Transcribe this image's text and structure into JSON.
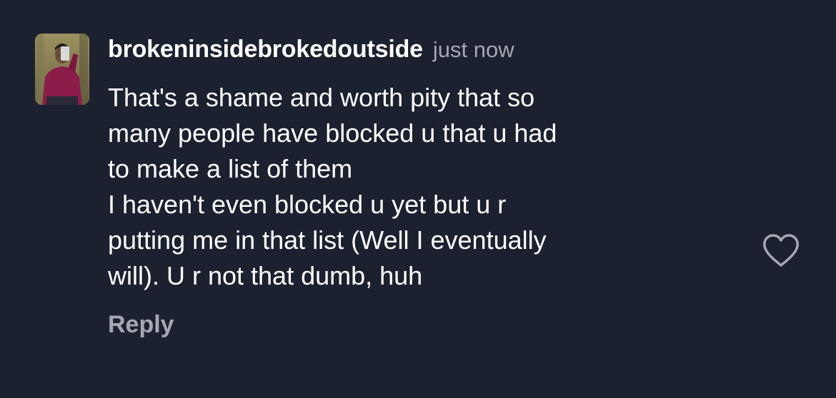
{
  "comment": {
    "username": "brokeninsidebrokedoutside",
    "timestamp": "just now",
    "text_lines": [
      "That's a shame and worth pity that so",
      "many people have blocked u that u had",
      "to make a list of them",
      "I haven't even blocked u yet but u r",
      "putting me in that list (Well I eventually",
      "will). U r not that dumb, huh"
    ],
    "reply_label": "Reply",
    "like_icon": "heart-outline-icon"
  },
  "colors": {
    "background": "#1c2130",
    "text": "#ffffff",
    "muted": "#a3a8b2"
  }
}
